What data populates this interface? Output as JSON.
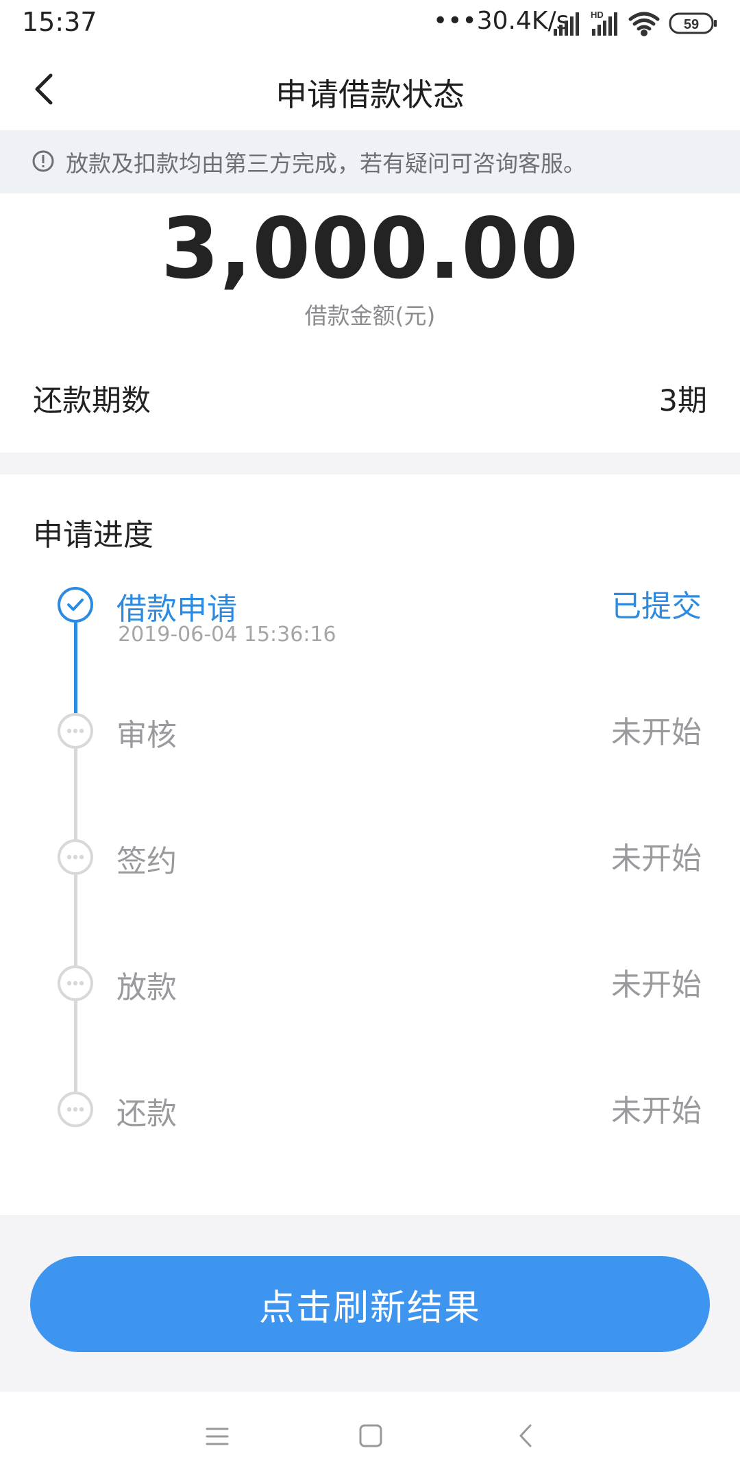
{
  "status_bar": {
    "time": "15:37",
    "network_speed": "•••30.4K/s",
    "battery": "59"
  },
  "header": {
    "title": "申请借款状态"
  },
  "notice": {
    "text": "放款及扣款均由第三方完成，若有疑问可咨询客服。"
  },
  "loan": {
    "amount": "3,000.00",
    "amount_label": "借款金额(元)",
    "term_label": "还款期数",
    "term_value": "3期"
  },
  "progress": {
    "title": "申请进度",
    "steps": [
      {
        "name": "借款申请",
        "status": "已提交",
        "time": "2019-06-04 15:36:16",
        "state": "done"
      },
      {
        "name": "审核",
        "status": "未开始",
        "state": "pending"
      },
      {
        "name": "签约",
        "status": "未开始",
        "state": "pending"
      },
      {
        "name": "放款",
        "status": "未开始",
        "state": "pending"
      },
      {
        "name": "还款",
        "status": "未开始",
        "state": "pending"
      }
    ]
  },
  "actions": {
    "refresh_label": "点击刷新结果"
  },
  "colors": {
    "accent": "#3d95ef",
    "done": "#2c8be0",
    "pending_text": "#9a9a9e",
    "pending_line": "#d8d8da"
  }
}
